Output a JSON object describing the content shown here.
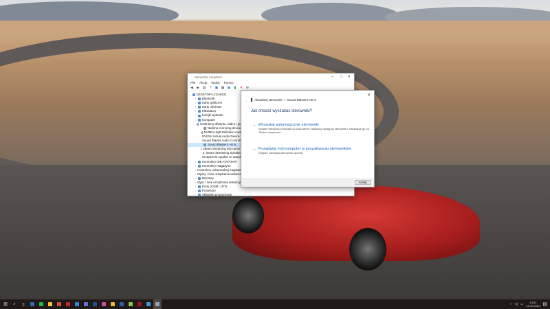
{
  "device_manager": {
    "title": "Menedżer urządzeń",
    "menu": [
      "Plik",
      "Akcja",
      "Widok",
      "Pomoc"
    ],
    "tree": [
      {
        "label": "DESKTOP-LC2UKDG",
        "level": 0,
        "icon": "computer-icon"
      },
      {
        "label": "Bluetooth",
        "level": 1,
        "icon": "bluetooth-icon"
      },
      {
        "label": "Karty graficzne",
        "level": 1,
        "icon": "display-adapter-icon"
      },
      {
        "label": "Karty sieciowe",
        "level": 1,
        "icon": "network-icon"
      },
      {
        "label": "Klawiatury",
        "level": 1,
        "icon": "keyboard-icon"
      },
      {
        "label": "Kolejki wydruku",
        "level": 1,
        "icon": "printer-icon"
      },
      {
        "label": "Komputer",
        "level": 1,
        "icon": "computer-icon"
      },
      {
        "label": "Kontrolery dźwięku, wideo i gier",
        "level": 1,
        "icon": "speaker-icon"
      },
      {
        "label": "Nahimic mirroring device",
        "level": 2,
        "icon": "speaker-icon"
      },
      {
        "label": "NVIDIA High Definition Audio",
        "level": 2,
        "icon": "speaker-icon"
      },
      {
        "label": "NVIDIA Virtual Audio Device (Wave Extensible)",
        "level": 2,
        "icon": "speaker-icon"
      },
      {
        "label": "Sound Blaster Audio Controller",
        "level": 2,
        "icon": "speaker-icon"
      },
      {
        "label": "Sound BlasterX AE-5",
        "level": 2,
        "icon": "speaker-icon",
        "selected": true
      },
      {
        "label": "Steam Streaming Microphone",
        "level": 2,
        "icon": "speaker-icon"
      },
      {
        "label": "Steam Streaming Speakers",
        "level": 2,
        "icon": "speaker-icon"
      },
      {
        "label": "Urządzenie zgodne ze standardem",
        "level": 2,
        "icon": "speaker-icon"
      },
      {
        "label": "Kontrolery IDE ATA/ATAPI",
        "level": 1,
        "icon": "controller-icon"
      },
      {
        "label": "Kontrolery magazynu",
        "level": 1,
        "icon": "storage-icon"
      },
      {
        "label": "Kontrolery uniwersalnej magistrali szeregowej",
        "level": 1,
        "icon": "usb-icon"
      },
      {
        "label": "Myszy i inne urządzenia wskazujące",
        "level": 1,
        "icon": "mouse-icon"
      },
      {
        "label": "Monitory",
        "level": 1,
        "icon": "monitor-icon"
      },
      {
        "label": "Mysz i inne urządzenia wskazujące",
        "level": 1,
        "icon": "mouse-icon"
      },
      {
        "label": "Porty (COM i LPT)",
        "level": 1,
        "icon": "port-icon"
      },
      {
        "label": "Procesory",
        "level": 1,
        "icon": "cpu-icon"
      },
      {
        "label": "Składniki programowe",
        "level": 1,
        "icon": "component-icon"
      }
    ]
  },
  "dialog": {
    "header": "Aktualizuj sterowniki — Sound BlasterX AE-5",
    "question": "Jak chcesz wyszukać sterowniki?",
    "option1_title": "Wyszukaj automatycznie sterowniki",
    "option1_desc": "System Windows wyszuka na komputerze najlepszy dostępny sterownik i zainstaluje go na Twoim urządzeniu.",
    "option2_title": "Przeglądaj mój komputer w poszukiwaniu sterowników",
    "option2_desc": "Znajdź i zainstaluj sterownik ręcznie.",
    "cancel": "Anuluj"
  },
  "taskbar": {
    "apps": [
      {
        "name": "steam",
        "color": "#2a6fb0"
      },
      {
        "name": "spotify",
        "color": "#1db954"
      },
      {
        "name": "file-explorer",
        "color": "#f3c03a"
      },
      {
        "name": "chrome",
        "color": "#d94a38"
      },
      {
        "name": "app-red",
        "color": "#c0262a"
      },
      {
        "name": "app-blue",
        "color": "#3b7bd6"
      },
      {
        "name": "app-purple",
        "color": "#6b6fd6"
      },
      {
        "name": "photoshop",
        "color": "#1f4e8c"
      },
      {
        "name": "app-pink",
        "color": "#c44fa0"
      },
      {
        "name": "folder",
        "color": "#e8b540"
      },
      {
        "name": "word",
        "color": "#2b5fb4"
      },
      {
        "name": "notepad",
        "color": "#8fc24a"
      },
      {
        "name": "app-darkred",
        "color": "#a0141a"
      },
      {
        "name": "app-cyan",
        "color": "#3a9ad9"
      },
      {
        "name": "device-manager",
        "color": "#9aa3ad"
      }
    ],
    "time": "14:41",
    "date": "15.10.2020"
  }
}
